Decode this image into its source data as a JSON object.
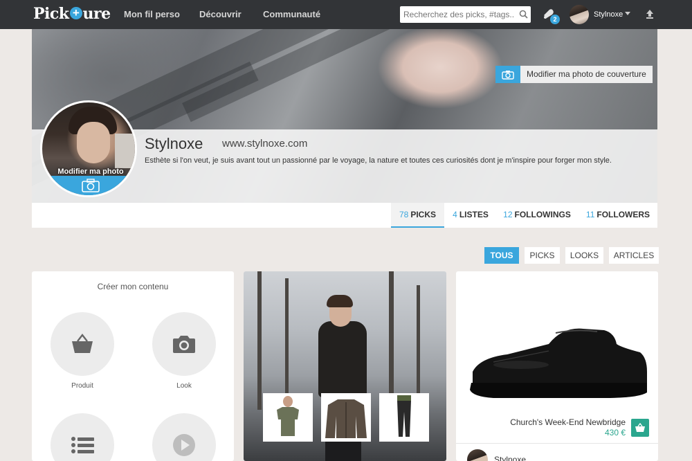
{
  "nav": {
    "logo_prefix": "Pick",
    "logo_plus": "+",
    "logo_suffix": "ure",
    "links": [
      "Mon fil perso",
      "Découvrir",
      "Communauté"
    ],
    "search_placeholder": "Recherchez des picks, #tags...",
    "notification_count": "2",
    "username": "Stylnoxe",
    "icons": [
      "search-icon",
      "bell-icon",
      "caret-down-icon",
      "upload-icon"
    ]
  },
  "cover": {
    "edit_cover_label": "Modifier ma photo de couverture"
  },
  "profile": {
    "name": "Stylnoxe",
    "website": "www.stylnoxe.com",
    "bio": "Esthète si l'on veut, je suis avant tout un passionné par le voyage, la nature et toutes ces curiosités dont je m'inspire pour forger mon style.",
    "edit_photo_label": "Modifier ma photo"
  },
  "tabs": [
    {
      "count": "78",
      "label": "PICKS",
      "active": true
    },
    {
      "count": "4",
      "label": "LISTES",
      "active": false
    },
    {
      "count": "12",
      "label": "FOLLOWINGS",
      "active": false
    },
    {
      "count": "11",
      "label": "FOLLOWERS",
      "active": false
    }
  ],
  "filters": [
    {
      "label": "TOUS",
      "active": true
    },
    {
      "label": "PICKS",
      "active": false
    },
    {
      "label": "LOOKS",
      "active": false
    },
    {
      "label": "ARTICLES",
      "active": false
    }
  ],
  "create_card": {
    "title": "Créer mon contenu",
    "options": [
      {
        "label": "Produit",
        "icon": "basket-icon"
      },
      {
        "label": "Look",
        "icon": "camera-icon"
      },
      {
        "label": "",
        "icon": "list-icon"
      },
      {
        "label": "",
        "icon": "play-icon"
      }
    ]
  },
  "product_card": {
    "name": "Church's Week-End Newbridge",
    "price": "430 €",
    "author": "Stylnoxe"
  },
  "colors": {
    "accent": "#3aa6dd",
    "nav_bg": "#323437",
    "page_bg": "#ede9e6",
    "price_green": "#2aa68e"
  }
}
